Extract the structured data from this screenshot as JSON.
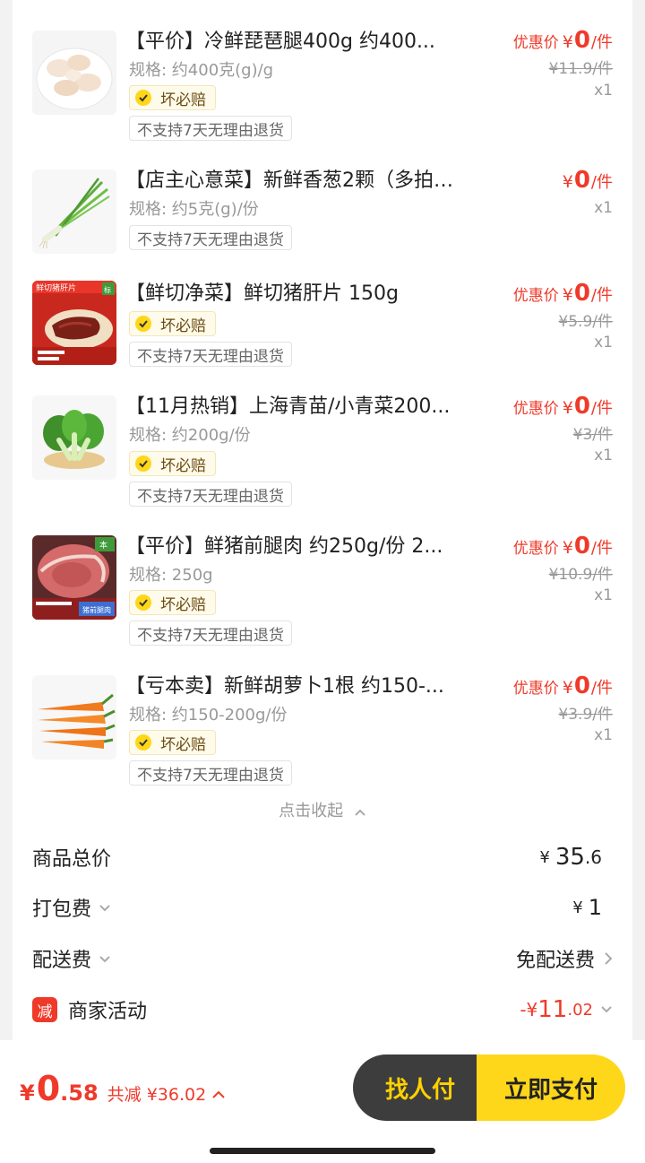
{
  "top_partial": "》",
  "items": [
    {
      "title": "【平价】冷鲜琵琶腿400g 约400...",
      "spec": "规格: 约400克(g)/g",
      "badge": "坏必赔",
      "return": "不支持7天无理由退货",
      "price_label": "优惠价",
      "price_yen": "¥",
      "price": "0",
      "unit": "/件",
      "orig": "¥11.9/件",
      "qty": "x1"
    },
    {
      "title": "【店主心意菜】新鲜香葱2颗（多拍不...",
      "spec": "规格: 约5克(g)/份",
      "badge": "",
      "return": "不支持7天无理由退货",
      "price_label": "",
      "price_yen": "¥",
      "price": "0",
      "unit": "/件",
      "orig": "",
      "qty": "x1"
    },
    {
      "title": "【鲜切净菜】鲜切猪肝片 150g",
      "spec": "",
      "badge": "坏必赔",
      "return": "不支持7天无理由退货",
      "price_label": "优惠价",
      "price_yen": "¥",
      "price": "0",
      "unit": "/件",
      "orig": "¥5.9/件",
      "qty": "x1"
    },
    {
      "title": "【11月热销】上海青苗/小青菜200...",
      "spec": "规格: 约200g/份",
      "badge": "坏必赔",
      "return": "不支持7天无理由退货",
      "price_label": "优惠价",
      "price_yen": "¥",
      "price": "0",
      "unit": "/件",
      "orig": "¥3/件",
      "qty": "x1"
    },
    {
      "title": "【平价】鲜猪前腿肉 约250g/份 2...",
      "spec": "规格: 250g",
      "badge": "坏必赔",
      "return": "不支持7天无理由退货",
      "price_label": "优惠价",
      "price_yen": "¥",
      "price": "0",
      "unit": "/件",
      "orig": "¥10.9/件",
      "qty": "x1"
    },
    {
      "title": "【亏本卖】新鲜胡萝卜1根 约150-...",
      "spec": "规格: 约150-200g/份",
      "badge": "坏必赔",
      "return": "不支持7天无理由退货",
      "price_label": "优惠价",
      "price_yen": "¥",
      "price": "0",
      "unit": "/件",
      "orig": "¥3.9/件",
      "qty": "x1"
    }
  ],
  "thumb_text": {
    "liver_banner": "鲜切猪肝片",
    "liver_logo": "标",
    "pork_logo": "本",
    "pork_label": "猪前腿肉"
  },
  "collapse_label": "点击收起",
  "summary": {
    "goods_total_label": "商品总价",
    "goods_total_yen": "¥",
    "goods_total_int": "35",
    "goods_total_dec": ".6",
    "packing_label": "打包费",
    "packing_yen": "¥",
    "packing_value": "1",
    "delivery_label": "配送费",
    "delivery_value": "免配送费",
    "promo_icon": "减",
    "promo_label": "商家活动",
    "promo_prefix": "-¥",
    "promo_int": "11",
    "promo_dec": ".02"
  },
  "footer": {
    "total_yen": "¥",
    "total_int": "0",
    "total_dec": ".58",
    "saved_label": "共减",
    "saved_value": "¥36.02",
    "pay_other_label": "找人付",
    "pay_label": "立即支付"
  },
  "colors": {
    "accent": "#ef3a2a",
    "yellow": "#ffd71a",
    "dark": "#3d3d3d"
  }
}
